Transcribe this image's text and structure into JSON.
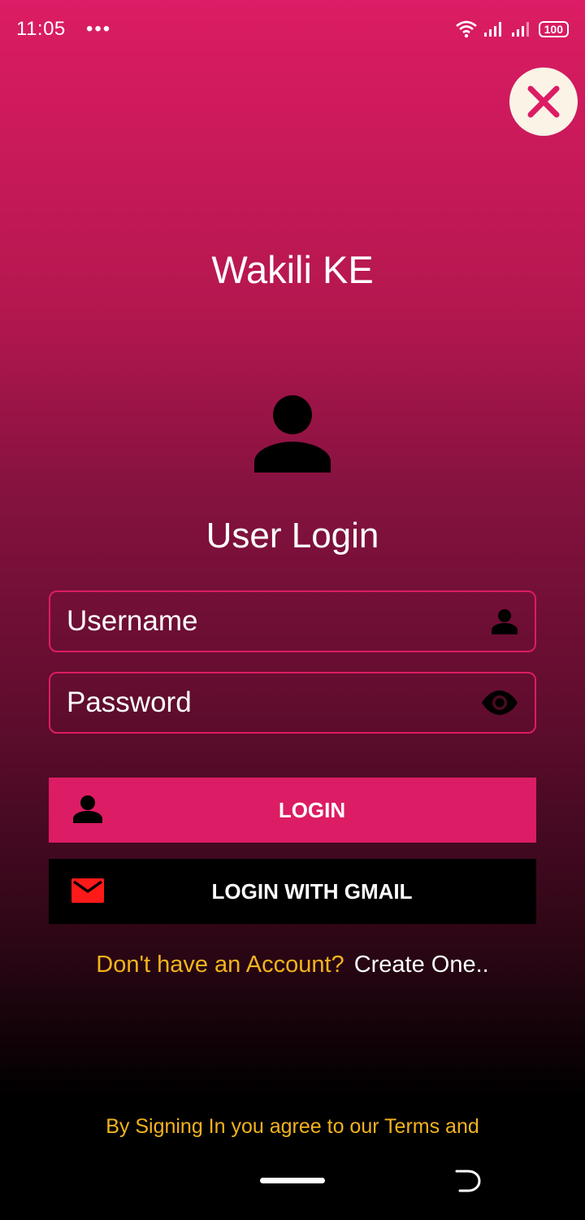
{
  "status_bar": {
    "time": "11:05",
    "dots": "•••",
    "battery": "100"
  },
  "app": {
    "title": "Wakili KE"
  },
  "login": {
    "title": "User Login",
    "username_placeholder": "Username",
    "password_placeholder": "Password",
    "login_button": "LOGIN",
    "gmail_button": "LOGIN WITH GMAIL",
    "no_account_text": "Don't have an Account?",
    "create_link": "Create One..",
    "terms_text": "By Signing In you agree to our Terms and"
  },
  "icons": {
    "close": "close-icon",
    "avatar": "user-icon",
    "username": "person-icon",
    "password": "eye-icon",
    "login": "person-icon",
    "gmail": "mail-icon"
  },
  "colors": {
    "accent": "#dc1c64",
    "link_yellow": "#f4b31d",
    "gmail_red": "#ff1a1a",
    "close_bg": "#faf3e6"
  }
}
